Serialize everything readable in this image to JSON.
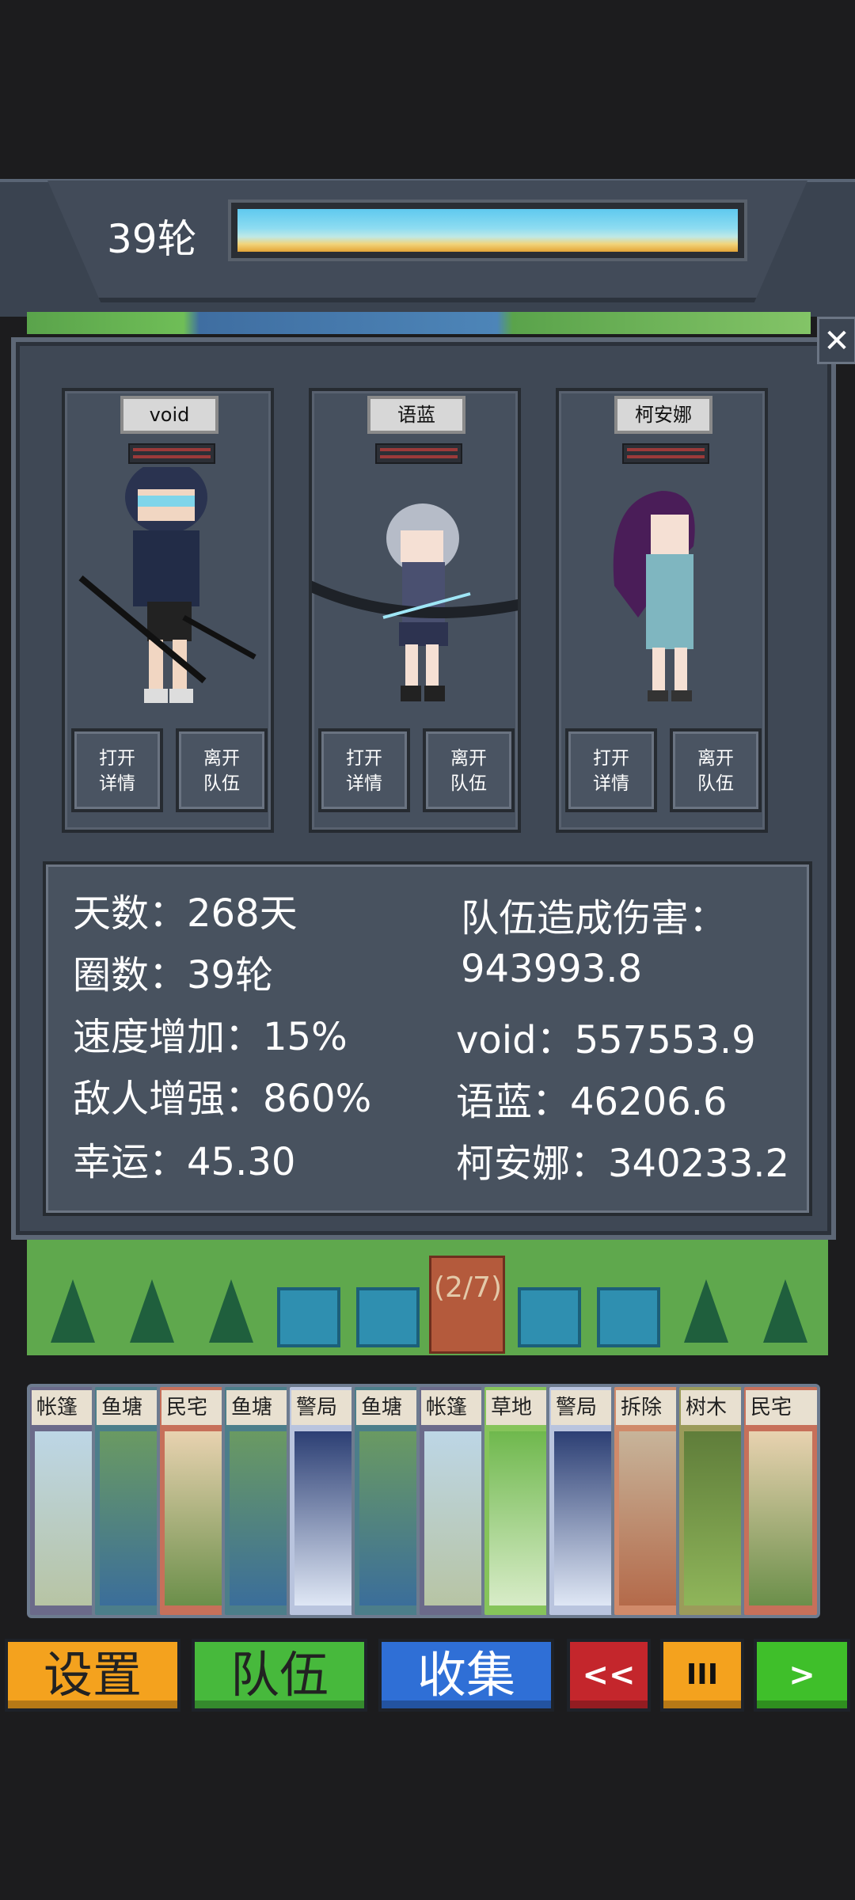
{
  "header": {
    "round_label": "39轮"
  },
  "team": [
    {
      "name": "void",
      "details_btn": "打开\n详情",
      "leave_btn": "离开\n队伍"
    },
    {
      "name": "语蓝",
      "details_btn": "打开\n详情",
      "leave_btn": "离开\n队伍"
    },
    {
      "name": "柯安娜",
      "details_btn": "打开\n详情",
      "leave_btn": "离开\n队伍"
    }
  ],
  "stats": {
    "days": "天数：268天",
    "rounds": "圈数：39轮",
    "speed": "速度增加：15%",
    "enemy": "敌人增强：860%",
    "luck": "幸运：45.30",
    "damage_label": "队伍造成伤害：",
    "damage_total": "943993.8",
    "dmg_void": "void：557553.9",
    "dmg_yulan": "语蓝：46206.6",
    "dmg_keanna": "柯安娜：340233.2"
  },
  "map": {
    "progress": "(2/7)"
  },
  "deck": [
    "帐篷",
    "鱼塘",
    "民宅",
    "鱼塘",
    "警局",
    "鱼塘",
    "帐篷",
    "草地",
    "警局",
    "拆除",
    "树木",
    "民宅"
  ],
  "buttons": {
    "settings": "设置",
    "team": "队伍",
    "collect": "收集",
    "rewind": "<<",
    "pause": "III",
    "play": ">"
  },
  "colors": {
    "settings": "#f4a21e",
    "team": "#47b93c",
    "collect": "#2f6fd6",
    "rewind": "#c4262c",
    "pause": "#f4a21e",
    "play": "#3fbf2a"
  }
}
